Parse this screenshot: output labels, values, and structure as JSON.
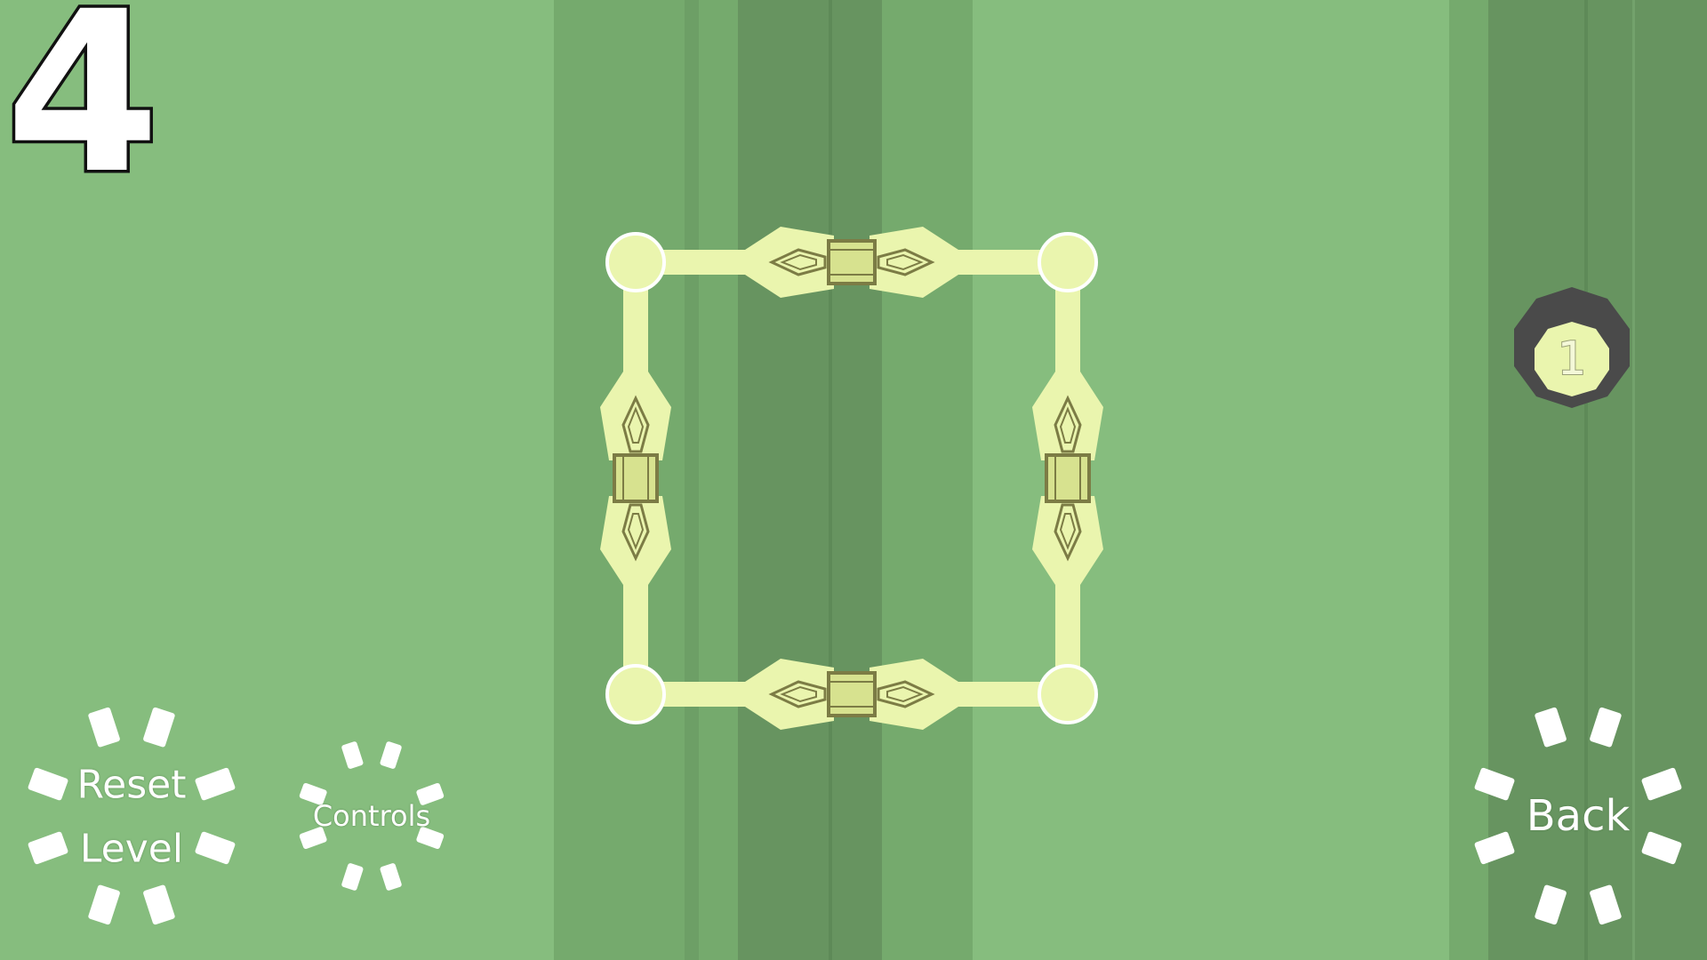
{
  "level": {
    "number": "4"
  },
  "move_counter": {
    "value": "1"
  },
  "buttons": {
    "reset_line1": "Reset",
    "reset_line2": "Level",
    "controls": "Controls",
    "back": "Back"
  },
  "colors": {
    "background": "#86bd7e",
    "stripe_mid": "#75aa6d",
    "stripe_dark": "#679460",
    "stripe_line": "#5e8a58",
    "piece": "#eaf5ae",
    "piece_outline": "#7c7c45",
    "node_border": "#ffffff",
    "counter_ring": "#4a4a4a",
    "counter_fill": "#eaf5ae"
  },
  "icons": {
    "node": "circle-node",
    "edge_piece": "diamond-connector",
    "move_counter": "octagon-badge"
  }
}
